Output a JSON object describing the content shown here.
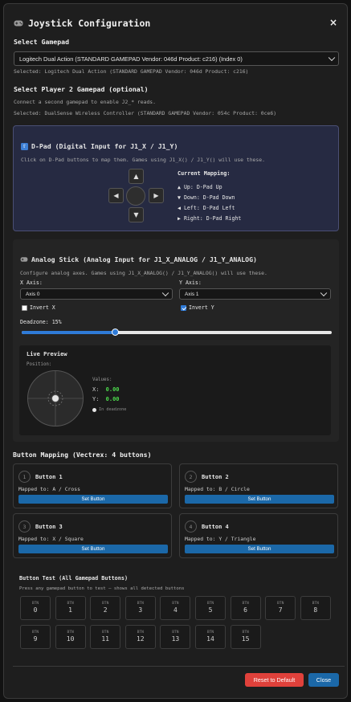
{
  "title": "Joystick Configuration",
  "icons": {
    "title": "gamepad-icon",
    "close": "close-icon",
    "dpad": "arrow-up-box-icon",
    "analog": "gamepad-icon"
  },
  "colors": {
    "accent": "#1b68a8",
    "danger": "#e0413b",
    "green": "#4cd84c",
    "dpad_panel": "#262a42"
  },
  "gamepad": {
    "heading": "Select Gamepad",
    "selected_option": "Logitech Dual Action (STANDARD GAMEPAD Vendor: 046d Product: c216) (Index 0)",
    "selected_info": "Selected: Logitech Dual Action (STANDARD GAMEPAD Vendor: 046d Product: c216)"
  },
  "player2": {
    "heading": "Select Player 2 Gamepad (optional)",
    "hint": "Connect a second gamepad to enable J2_* reads.",
    "selected_info": "Selected: DualSense Wireless Controller (STANDARD GAMEPAD Vendor: 054c Product: 0ce6)"
  },
  "dpad": {
    "heading": "D-Pad (Digital Input for J1_X / J1_Y)",
    "hint": "Click on D-Pad buttons to map them. Games using J1_X() / J1_Y() will use these.",
    "mapping_title": "Current Mapping:",
    "mappings": [
      "▲ Up: D-Pad Up",
      "▼ Down: D-Pad Down",
      "◀ Left: D-Pad Left",
      "▶ Right: D-Pad Right"
    ],
    "arrows": {
      "up": "▲",
      "down": "▼",
      "left": "◀",
      "right": "▶"
    }
  },
  "analog": {
    "heading": "Analog Stick (Analog Input for J1_X_ANALOG / J1_Y_ANALOG)",
    "hint": "Configure analog axes. Games using J1_X_ANALOG() / J1_Y_ANALOG() will use these.",
    "x_label": "X Axis:",
    "y_label": "Y Axis:",
    "x_value": "Axis 0",
    "y_value": "Axis 1",
    "invert_x_label": "Invert X",
    "invert_y_label": "Invert Y",
    "invert_x": false,
    "invert_y": true,
    "deadzone_label": "Deadzone: 15%",
    "deadzone": 0.15,
    "preview": {
      "heading": "Live Preview",
      "position_label": "Position:",
      "values_label": "Values:",
      "x_label": "X:",
      "x_value": "0.00",
      "y_label": "Y:",
      "y_value": "0.00",
      "deadzone_note": "In deadzone"
    }
  },
  "buttons": {
    "heading": "Button Mapping (Vectrex: 4 buttons)",
    "set_label": "Set Button",
    "items": [
      {
        "num": "1",
        "title": "Button 1",
        "mapped": "Mapped to: A / Cross"
      },
      {
        "num": "2",
        "title": "Button 2",
        "mapped": "Mapped to: B / Circle"
      },
      {
        "num": "3",
        "title": "Button 3",
        "mapped": "Mapped to: X / Square"
      },
      {
        "num": "4",
        "title": "Button 4",
        "mapped": "Mapped to: Y / Triangle"
      }
    ]
  },
  "test": {
    "heading": "Button Test (All Gamepad Buttons)",
    "hint": "Press any gamepad button to test — shows all detected buttons",
    "btn_label": "BTN",
    "numbers": [
      "0",
      "1",
      "2",
      "3",
      "4",
      "5",
      "6",
      "7",
      "8",
      "9",
      "10",
      "11",
      "12",
      "13",
      "14",
      "15"
    ]
  },
  "footer": {
    "reset": "Reset to Default",
    "close": "Close"
  }
}
